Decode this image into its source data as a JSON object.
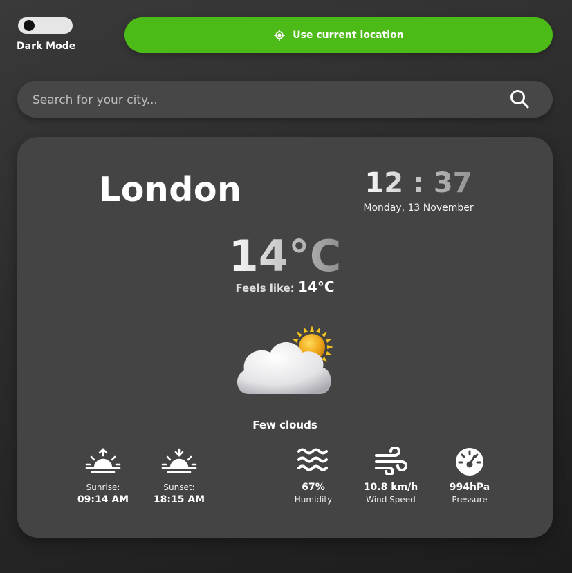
{
  "dark_mode": {
    "label": "Dark Mode",
    "enabled": false
  },
  "location_button": {
    "label": "Use current location",
    "icon": "crosshair-icon"
  },
  "search": {
    "placeholder": "Search for your city...",
    "icon": "search-icon"
  },
  "weather": {
    "city": "London",
    "time": "12 : 37",
    "date": "Monday, 13 November",
    "temperature": "14°C",
    "feels_like_label": "Feels like:",
    "feels_like_value": "14°C",
    "condition": "Few clouds",
    "condition_icon": "cloud-sun-icon"
  },
  "sun": {
    "sunrise_label": "Sunrise:",
    "sunrise_value": "09:14 AM",
    "sunset_label": "Sunset:",
    "sunset_value": "18:15 AM"
  },
  "metrics": {
    "humidity_value": "67%",
    "humidity_label": "Humidity",
    "wind_value": "10.8 km/h",
    "wind_label": "Wind Speed",
    "pressure_value": "994hPa",
    "pressure_label": "Pressure"
  },
  "colors": {
    "accent": "#4cbb17",
    "card": "#444444",
    "search": "#474747"
  }
}
